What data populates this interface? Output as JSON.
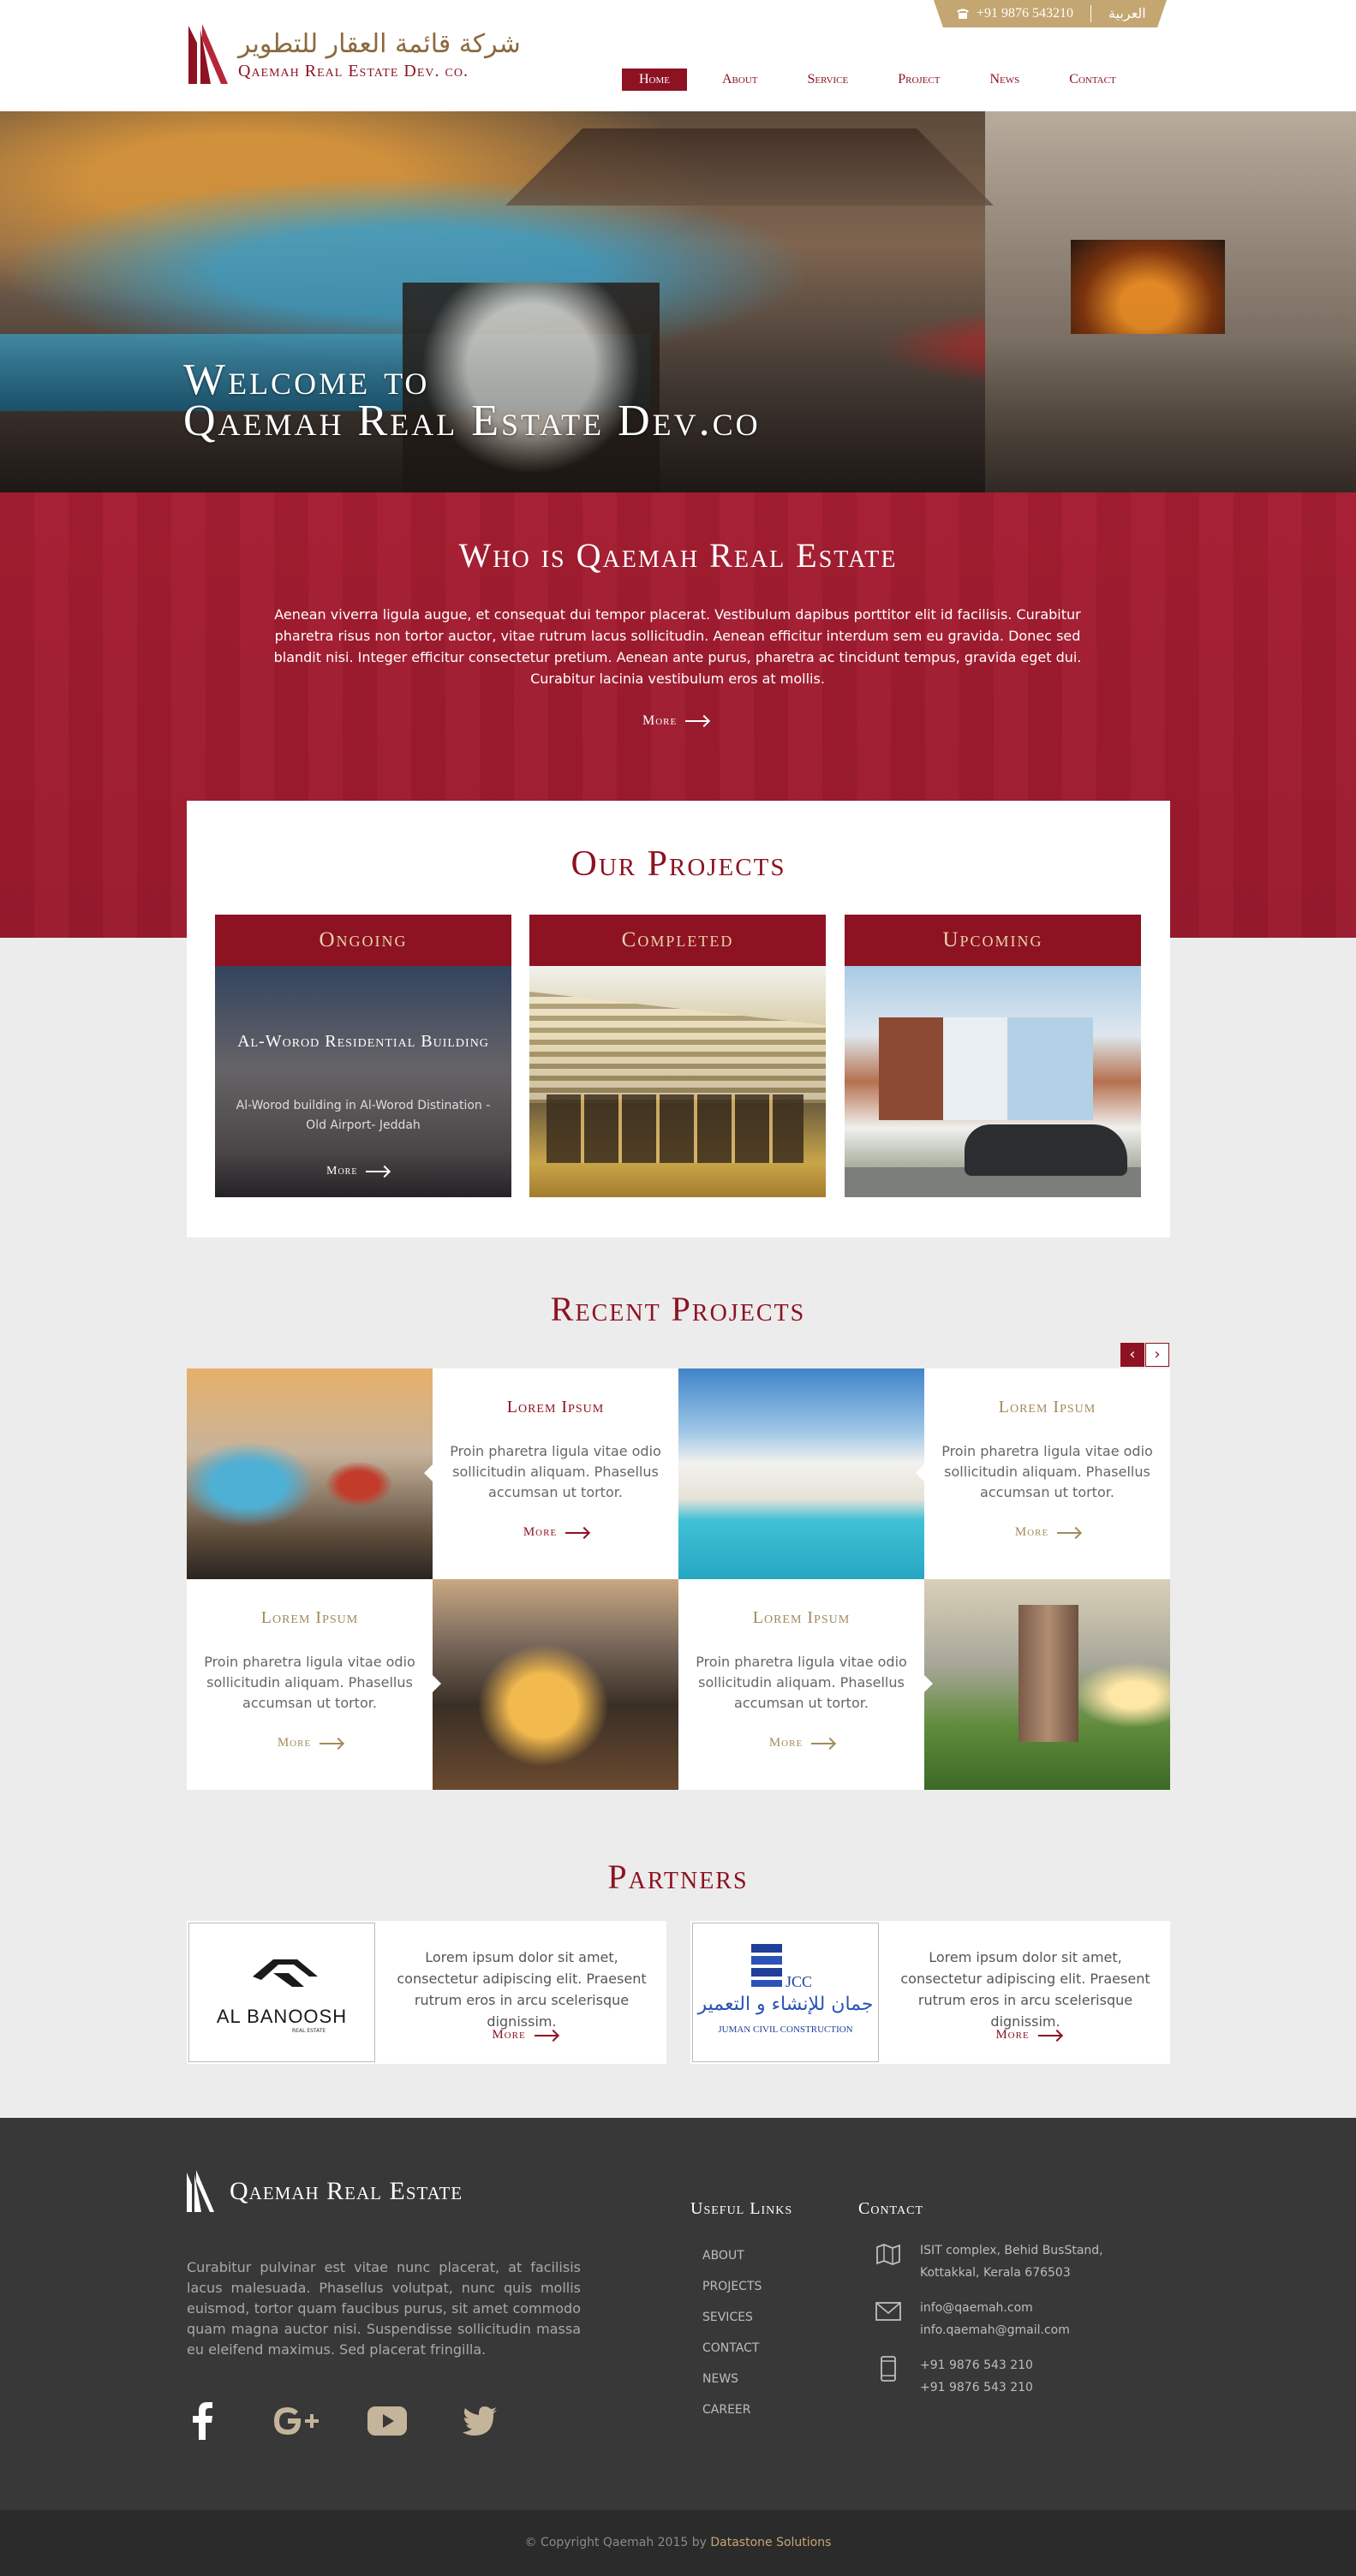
{
  "header": {
    "logo_arabic": "شركة قائمة العقار للتطوير",
    "logo_english": "Qaemah Real Estate Dev. co.",
    "phone": "+91 9876 543210",
    "language": "العربية",
    "nav": [
      "Home",
      "About",
      "Service",
      "Project",
      "News",
      "Contact"
    ],
    "active_nav": "Home"
  },
  "hero": {
    "line1": "Welcome to",
    "line2": "Qaemah Real Estate Dev.co"
  },
  "who": {
    "title": "Who is Qaemah Real Estate",
    "text": "Aenean viverra ligula augue, et consequat dui tempor placerat. Vestibulum dapibus porttitor elit id facilisis. Curabitur pharetra risus non tortor auctor, vitae rutrum lacus sollicitudin. Aenean efficitur interdum sem eu gravida. Donec sed blandit nisi. Integer efficitur consectetur pretium. Aenean ante purus, pharetra ac tincidunt tempus, gravida eget dui. Curabitur lacinia vestibulum eros at mollis.",
    "more": "More"
  },
  "our_projects": {
    "title": "Our Projects",
    "cards": [
      {
        "label": "Ongoing",
        "overlay_title": "Al-Worod Residential Building",
        "overlay_text": "Al-Worod building in Al-Worod Distination - Old Airport- Jeddah",
        "more": "More"
      },
      {
        "label": "Completed"
      },
      {
        "label": "Upcoming"
      }
    ]
  },
  "recent": {
    "title": "Recent  Projects",
    "prev": "‹",
    "next": "›",
    "items": [
      {
        "title": "Lorem Ipsum",
        "text": "Proin pharetra ligula vitae odio sollicitudin aliquam. Phasellus accumsan ut tortor.",
        "more": "More"
      },
      {
        "title": "Lorem Ipsum",
        "text": "Proin pharetra ligula vitae odio sollicitudin aliquam. Phasellus accumsan ut tortor.",
        "more": "More"
      },
      {
        "title": "Lorem Ipsum",
        "text": "Proin pharetra ligula vitae odio sollicitudin aliquam. Phasellus accumsan ut tortor.",
        "more": "More"
      },
      {
        "title": "Lorem Ipsum",
        "text": "Proin pharetra ligula vitae odio sollicitudin aliquam. Phasellus accumsan ut tortor.",
        "more": "More"
      }
    ]
  },
  "partners": {
    "title": "Partners",
    "items": [
      {
        "logo_text": "AL BANOOSH",
        "logo_sub": "REAL ESTATE",
        "text": "Lorem ipsum dolor sit amet, consectetur adipiscing elit. Praesent rutrum eros in arcu scelerisque dignissim.",
        "more": "More"
      },
      {
        "logo_text": "JCC",
        "logo_arabic": "جمان للإنشاء و التعمير",
        "logo_sub": "JUMAN CIVIL CONSTRUCTION",
        "text": "Lorem ipsum dolor sit amet, consectetur adipiscing elit. Praesent rutrum eros in arcu scelerisque dignissim.",
        "more": "More"
      }
    ]
  },
  "footer": {
    "brand": "Qaemah Real Estate",
    "about": "Curabitur pulvinar est vitae nunc placerat, at facilisis lacus malesuada. Phasellus volutpat, nunc quis mollis euismod, tortor quam faucibus purus, sit amet commodo quam magna auctor nisi. Suspendisse sollicitudin massa eu eleifend maximus. Sed placerat fringilla.",
    "social": [
      "facebook-icon",
      "google-plus-icon",
      "youtube-icon",
      "twitter-icon"
    ],
    "useful_links_title": "Useful Links",
    "links": [
      "ABOUT",
      "PROJECTS",
      "SEVICES",
      "CONTACT",
      "NEWS",
      "CAREER"
    ],
    "contact_title": "Contact",
    "address": [
      "ISIT complex, Behid BusStand,",
      "Kottakkal, Kerala 676503"
    ],
    "emails": [
      "info@qaemah.com",
      "info.qaemah@gmail.com"
    ],
    "phones": [
      "+91 9876 543 210",
      "+91 9876 543 210"
    ]
  },
  "copyright": {
    "text": "© Copyright Qaemah 2015 by",
    "credit": "Datastone Solutions"
  },
  "colors": {
    "brand_red": "#8d1222",
    "section_red": "#a51d31",
    "gold": "#c4a672",
    "footer_bg": "#383838"
  }
}
